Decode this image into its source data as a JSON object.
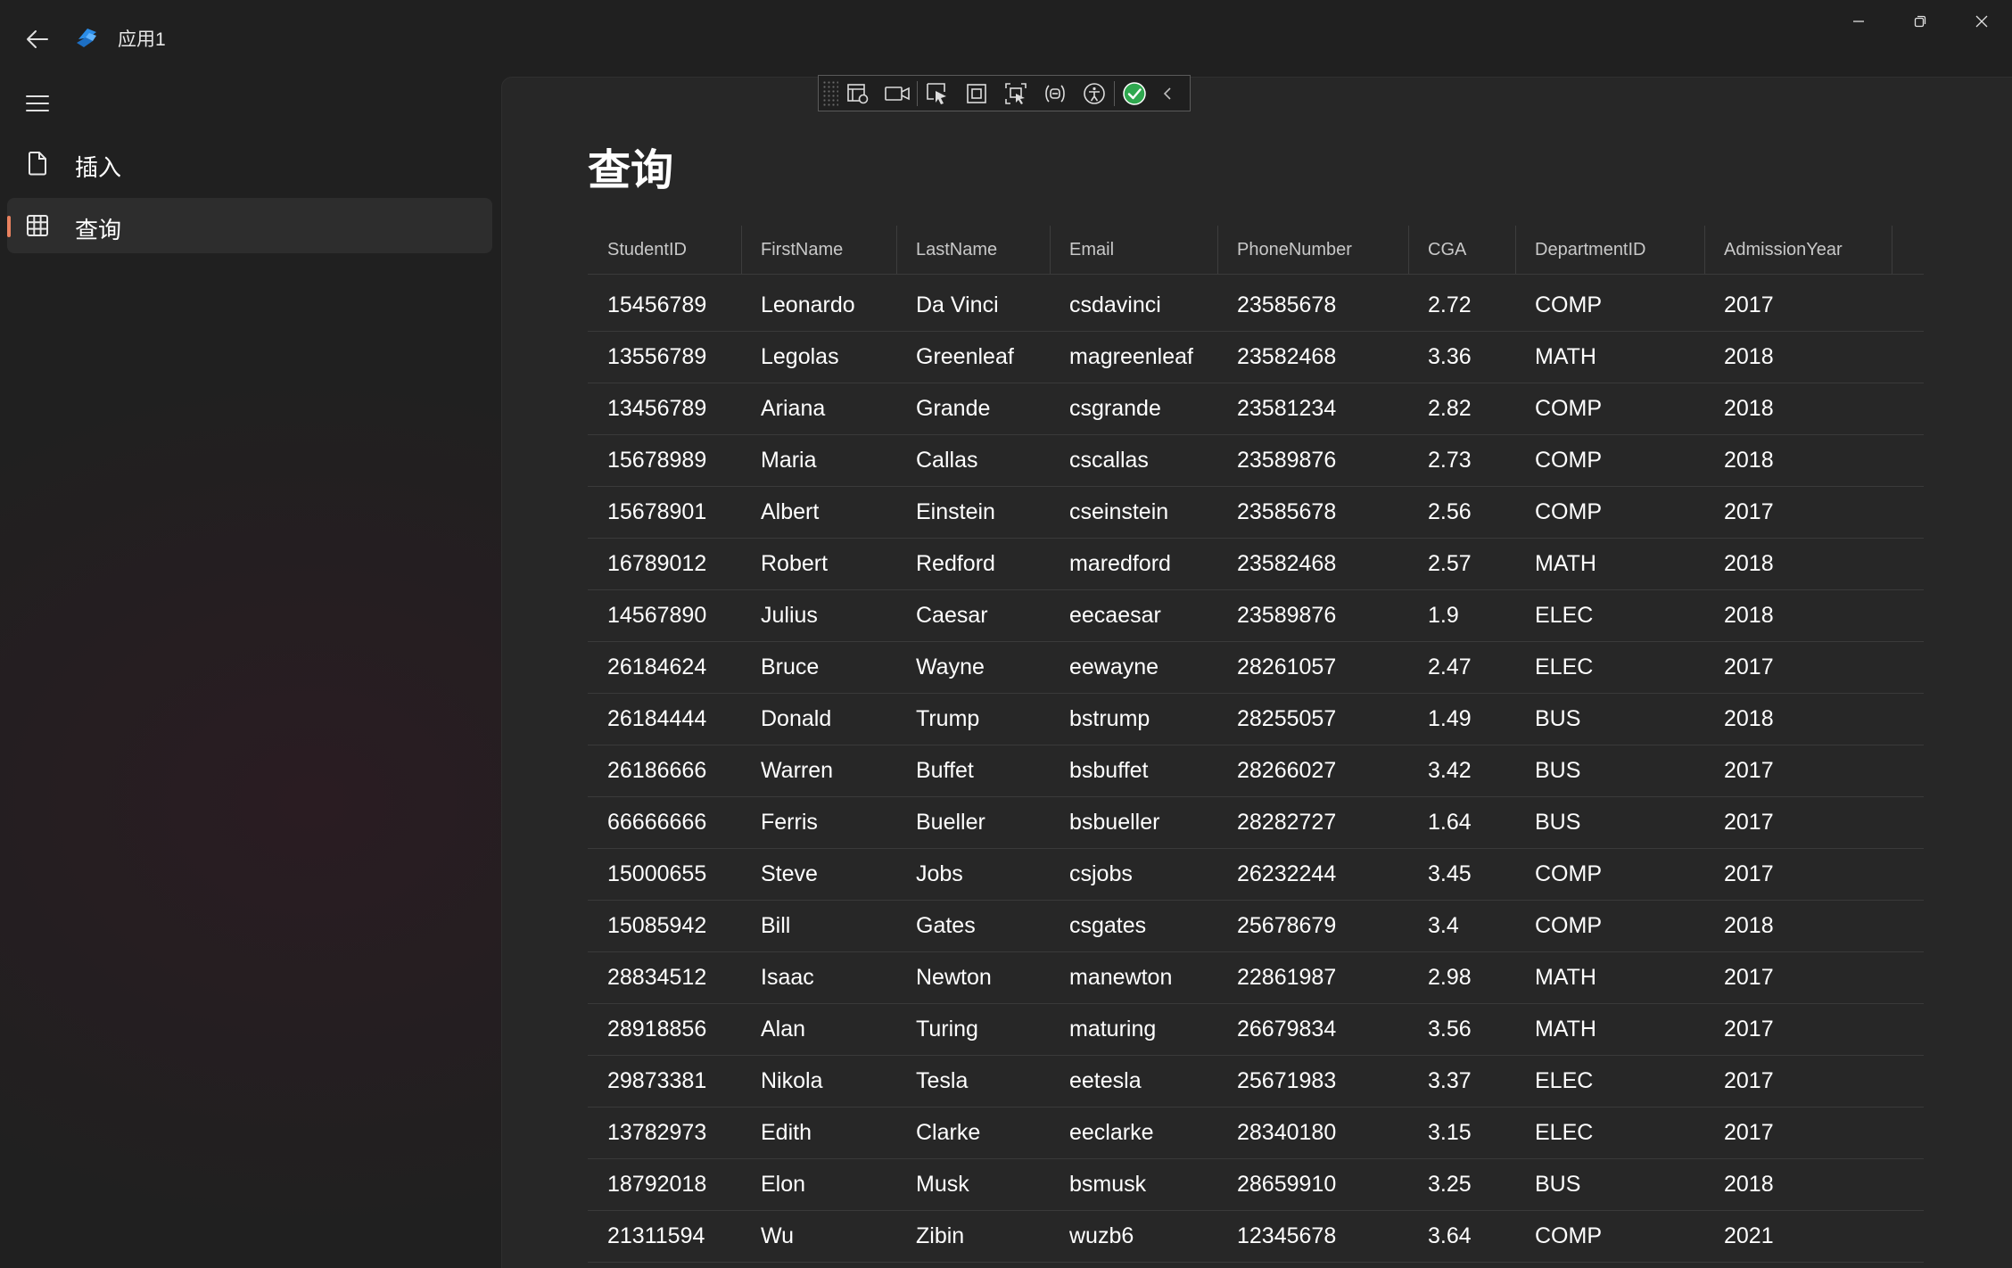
{
  "app": {
    "title": "应用1",
    "accent": "#e9825f",
    "logo_color": "#2b8de8"
  },
  "nav": {
    "items": [
      {
        "label": "插入",
        "icon": "document-icon",
        "selected": false
      },
      {
        "label": "查询",
        "icon": "table-grid-icon",
        "selected": true
      }
    ]
  },
  "page": {
    "title": "查询"
  },
  "devtools": {
    "buttons": [
      "live-visual-tree-icon",
      "record-video-icon",
      "select-element-icon",
      "display-layout-adorners-icon",
      "track-focus-icon",
      "binding-failures-icon",
      "accessibility-checker-icon",
      "xaml-hot-reload-ok-icon",
      "collapse-toolbar-icon"
    ]
  },
  "table": {
    "columns": [
      "StudentID",
      "FirstName",
      "LastName",
      "Email",
      "PhoneNumber",
      "CGA",
      "DepartmentID",
      "AdmissionYear"
    ],
    "rows": [
      [
        "15456789",
        "Leonardo",
        "Da Vinci",
        "csdavinci",
        "23585678",
        "2.72",
        "COMP",
        "2017"
      ],
      [
        "13556789",
        "Legolas",
        "Greenleaf",
        "magreenleaf",
        "23582468",
        "3.36",
        "MATH",
        "2018"
      ],
      [
        "13456789",
        "Ariana",
        "Grande",
        "csgrande",
        "23581234",
        "2.82",
        "COMP",
        "2018"
      ],
      [
        "15678989",
        "Maria",
        "Callas",
        "cscallas",
        "23589876",
        "2.73",
        "COMP",
        "2018"
      ],
      [
        "15678901",
        "Albert",
        "Einstein",
        "cseinstein",
        "23585678",
        "2.56",
        "COMP",
        "2017"
      ],
      [
        "16789012",
        "Robert",
        "Redford",
        "maredford",
        "23582468",
        "2.57",
        "MATH",
        "2018"
      ],
      [
        "14567890",
        "Julius",
        "Caesar",
        "eecaesar",
        "23589876",
        "1.9",
        "ELEC",
        "2018"
      ],
      [
        "26184624",
        "Bruce",
        "Wayne",
        "eewayne",
        "28261057",
        "2.47",
        "ELEC",
        "2017"
      ],
      [
        "26184444",
        "Donald",
        "Trump",
        "bstrump",
        "28255057",
        "1.49",
        "BUS",
        "2018"
      ],
      [
        "26186666",
        "Warren",
        "Buffet",
        "bsbuffet",
        "28266027",
        "3.42",
        "BUS",
        "2017"
      ],
      [
        "66666666",
        "Ferris",
        "Bueller",
        "bsbueller",
        "28282727",
        "1.64",
        "BUS",
        "2017"
      ],
      [
        "15000655",
        "Steve",
        "Jobs",
        "csjobs",
        "26232244",
        "3.45",
        "COMP",
        "2017"
      ],
      [
        "15085942",
        "Bill",
        "Gates",
        "csgates",
        "25678679",
        "3.4",
        "COMP",
        "2018"
      ],
      [
        "28834512",
        "Isaac",
        "Newton",
        "manewton",
        "22861987",
        "2.98",
        "MATH",
        "2017"
      ],
      [
        "28918856",
        "Alan",
        "Turing",
        "maturing",
        "26679834",
        "3.56",
        "MATH",
        "2017"
      ],
      [
        "29873381",
        "Nikola",
        "Tesla",
        "eetesla",
        "25671983",
        "3.37",
        "ELEC",
        "2017"
      ],
      [
        "13782973",
        "Edith",
        "Clarke",
        "eeclarke",
        "28340180",
        "3.15",
        "ELEC",
        "2017"
      ],
      [
        "18792018",
        "Elon",
        "Musk",
        "bsmusk",
        "28659910",
        "3.25",
        "BUS",
        "2018"
      ],
      [
        "21311594",
        "Wu",
        "Zibin",
        "wuzb6",
        "12345678",
        "3.64",
        "COMP",
        "2021"
      ]
    ]
  }
}
